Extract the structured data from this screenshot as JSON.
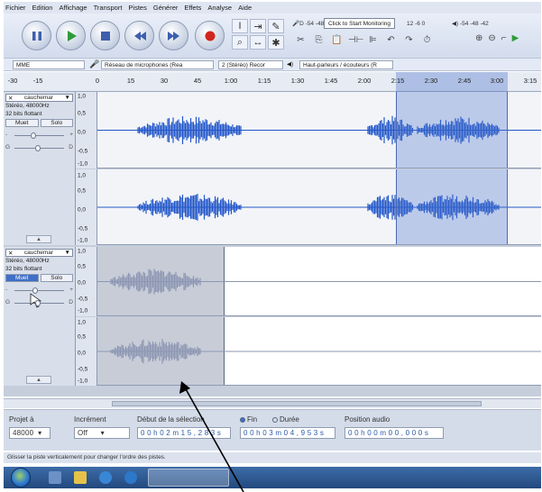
{
  "menu": [
    "Fichier",
    "Edition",
    "Affichage",
    "Transport",
    "Pistes",
    "Générer",
    "Effets",
    "Analyse",
    "Aide"
  ],
  "toolbar": {
    "buttons": [
      "pause",
      "play",
      "stop",
      "skip-start",
      "skip-end",
      "record"
    ],
    "monitor_label": "Click to Start Monitoring",
    "meter_left": "-54 -48",
    "meter_right": "-54 -48 -42",
    "meter_mid": "12 -6 0",
    "input_label": "D",
    "colors": {
      "play": "#2f9b3a",
      "record": "#d0261f",
      "transport": "#3e5fae"
    }
  },
  "devices": {
    "host": "MME",
    "input": "Réseau de microphones (Rea",
    "channels": "2 (Stéréo) Recor",
    "output": "Haut-parleurs / écouteurs (R"
  },
  "ruler": {
    "ticks": [
      "-30",
      "-15",
      "0",
      "15",
      "30",
      "45",
      "1:00",
      "1:15",
      "1:30",
      "1:45",
      "2:00",
      "2:15",
      "2:30",
      "2:45",
      "3:00",
      "3:15"
    ]
  },
  "tracks": [
    {
      "name": "cauchemar",
      "rate": "Stéréo, 48000Hz",
      "format": "32 bits flottant",
      "mute": "Muet",
      "solo": "Solo",
      "scale": [
        "1,0",
        "0,5",
        "0,0",
        "-0,5",
        "-1,0"
      ],
      "scale2": [
        "1,0",
        "0,5",
        "0,0",
        "-0,5",
        "-1,0"
      ]
    },
    {
      "name": "cauchemar",
      "rate": "Stéréo, 48000Hz",
      "format": "32 bits flottant",
      "mute": "Muet",
      "solo": "Solo",
      "scale": [
        "1,0",
        "0,5",
        "0,0",
        "-0,5",
        "-1,0"
      ],
      "scale2": [
        "1,0",
        "0,5",
        "0,0",
        "-0,5",
        "-1,0"
      ]
    }
  ],
  "selection_bar": {
    "project_rate_label": "Projet à",
    "project_rate": "48000",
    "snap_label": "Incrément",
    "snap": "Off",
    "start_label": "Début de la sélection",
    "end_label": "Fin",
    "length_label": "Durée",
    "start": "0 0 h 0 2 m 1 5 , 2 8 3 s",
    "end": "0 0 h 0 3 m 0 4 , 9 5 3 s",
    "audio_pos_label": "Position audio",
    "audio_pos": "0 0 h 0 0 m 0 0 , 0 0 0 s"
  },
  "status": "Glisser la piste verticalement pour changer l'ordre des pistes."
}
